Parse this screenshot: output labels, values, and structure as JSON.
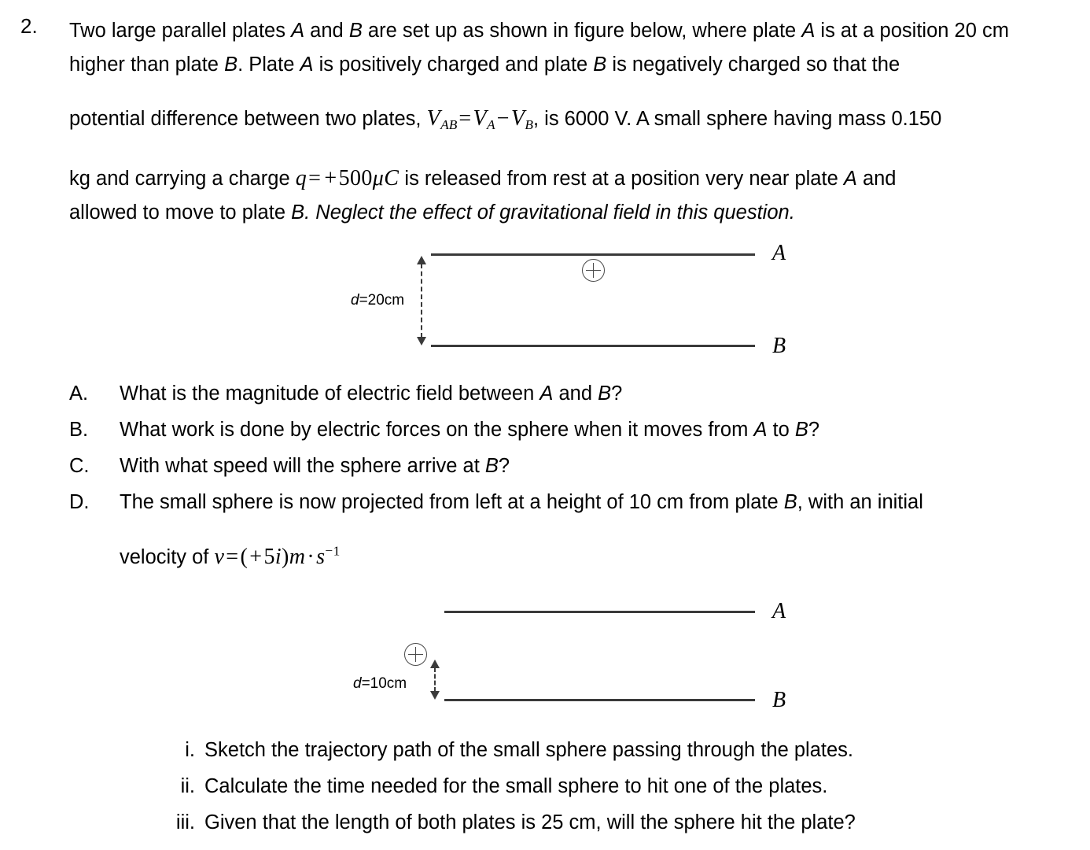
{
  "question": {
    "number": "2.",
    "paragraph1_part1": "Two large parallel plates ",
    "paragraph1_a": "A",
    "paragraph1_part2": " and ",
    "paragraph1_b": "B",
    "paragraph1_part3": " are set up as shown in figure below, where plate ",
    "paragraph1_a2": "A",
    "paragraph1_part4": " is at a position 20 cm higher than plate ",
    "paragraph1_b2": "B",
    "paragraph1_part5": ". Plate ",
    "paragraph1_a3": "A",
    "paragraph1_part6": " is positively charged and plate ",
    "paragraph1_b3": "B",
    "paragraph1_part7": " is negatively charged so that the",
    "line3_pre": "potential difference between two plates, ",
    "formula_vab": {
      "v1": "V",
      "sub1": "AB",
      "equals": "=",
      "v2": "V",
      "sub2": "A",
      "minus": "−",
      "v3": "V",
      "sub3": "B"
    },
    "line3_post": ", is 6000 V. A small sphere having mass 0.150",
    "line4_pre": "kg and carrying a charge ",
    "formula_q": {
      "q": "q",
      "equals": "=",
      "plus": "+",
      "value": "500",
      "mu": "μ",
      "c": "C"
    },
    "line4_post": " is released from rest at a position very near plate ",
    "line4_a": "A",
    "line4_end": " and",
    "line5_pre": "allowed to move to plate ",
    "line5_b": "B",
    "line5_italic": ". Neglect the effect of gravitational field in this question."
  },
  "figure1": {
    "plate_top_label": "A",
    "plate_bottom_label": "B",
    "dimension_d": "d",
    "dimension_value": "=20cm",
    "charge_symbol": "⊕"
  },
  "figure2": {
    "plate_top_label": "A",
    "plate_bottom_label": "B",
    "dimension_d": "d",
    "dimension_value": "=10cm",
    "charge_symbol": "⊕"
  },
  "alpha_items": [
    {
      "marker": "A.",
      "text_pre": "What is the magnitude of electric field between ",
      "em1": "A",
      "text_mid": " and ",
      "em2": "B",
      "text_post": "?"
    },
    {
      "marker": "B.",
      "text_pre": "What work is done by electric forces on the sphere when it moves from ",
      "em1": "A",
      "text_mid": " to ",
      "em2": "B",
      "text_post": "?"
    },
    {
      "marker": "C.",
      "text_pre": "With what speed will the sphere arrive at ",
      "em1": "B",
      "text_mid": "",
      "em2": "",
      "text_post": "?"
    },
    {
      "marker": "D.",
      "text_pre": "The small sphere is now projected from left at a height of 10 cm from plate ",
      "em1": "B",
      "text_mid": ", with an initial",
      "em2": "",
      "text_post": ""
    }
  ],
  "velocity_line": {
    "prefix": "velocity of ",
    "formula": {
      "v": "v",
      "equals": "=",
      "open": "(",
      "plus": "+",
      "five": "5",
      "i": "i",
      "close": ")",
      "m": "m",
      "dot": "·",
      "s": "s",
      "exp": "−1"
    }
  },
  "roman_items": [
    {
      "marker": "i.",
      "text": "Sketch the trajectory path of the small sphere passing through the plates."
    },
    {
      "marker": "ii.",
      "text": "Calculate the time needed for the small sphere to hit one of the plates."
    },
    {
      "marker": "iii.",
      "text": "Given that the length of both plates is 25 cm, will the sphere hit the plate?"
    }
  ],
  "colors": {
    "text": "#000000",
    "plate_line": "#3a3a3a",
    "charge_outline": "#4a4a4a",
    "background": "#ffffff"
  }
}
